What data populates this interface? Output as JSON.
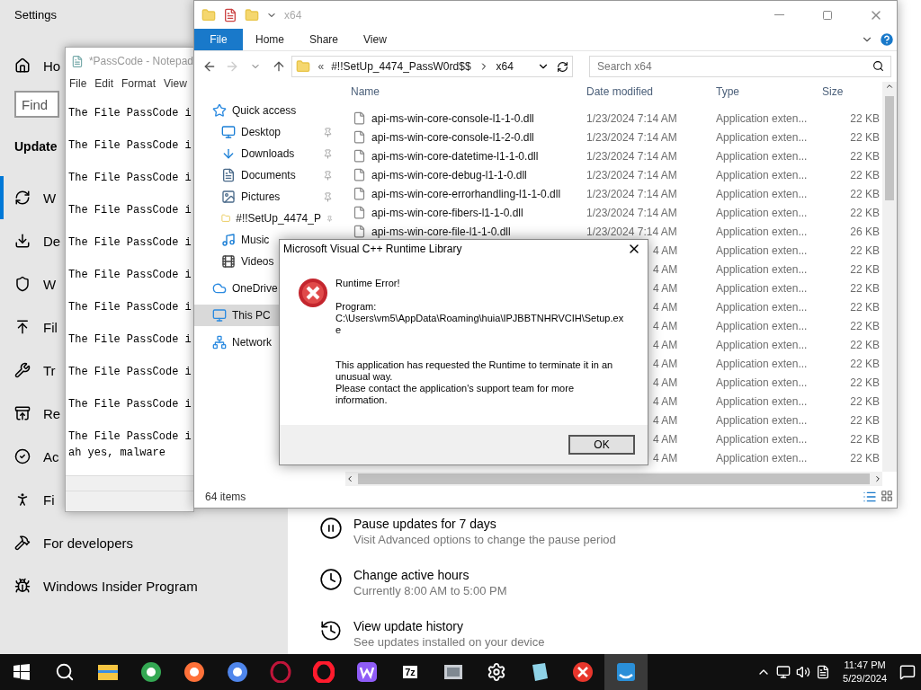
{
  "settings": {
    "title": "Settings",
    "home": "Ho",
    "search": {
      "placeholder": "Find"
    },
    "section": "Update",
    "nav": [
      {
        "label": "W",
        "selected": true
      },
      {
        "label": "De",
        "selected": false
      },
      {
        "label": "W",
        "selected": false
      },
      {
        "label": "Fil",
        "selected": false
      },
      {
        "label": "Tr",
        "selected": false
      },
      {
        "label": "Re",
        "selected": false
      },
      {
        "label": "Ac",
        "selected": false
      },
      {
        "label": "Fi",
        "selected": false
      },
      {
        "label": "For developers",
        "selected": false
      },
      {
        "label": "Windows Insider Program",
        "selected": false
      }
    ],
    "options": [
      {
        "title": "Pause updates for 7 days",
        "subtitle": "Visit Advanced options to change the pause period"
      },
      {
        "title": "Change active hours",
        "subtitle": "Currently 8:00 AM to 5:00 PM"
      },
      {
        "title": "View update history",
        "subtitle": "See updates installed on your device"
      }
    ]
  },
  "notepad": {
    "title": "*PassCode - Notepad",
    "menu": [
      "File",
      "Edit",
      "Format",
      "View"
    ],
    "lines": [
      "The File PassCode i",
      "The File PassCode i",
      "The File PassCode i",
      "The File PassCode i",
      "The File PassCode i",
      "The File PassCode i",
      "The File PassCode i",
      "The File PassCode i",
      "The File PassCode i",
      "The File PassCode i",
      "The File PassCode i",
      "ah yes, malware"
    ]
  },
  "explorer": {
    "title": "x64",
    "file_menu": "File",
    "ribbon_tabs": [
      "Home",
      "Share",
      "View"
    ],
    "address": {
      "prefix": "«",
      "crumbs": [
        "#!!SetUp_4474_PassW0rd$$",
        "x64"
      ]
    },
    "search": {
      "placeholder": "Search x64"
    },
    "nav": [
      {
        "kind": "group",
        "label": "Quick access",
        "selected": false
      },
      {
        "kind": "item",
        "label": "Desktop",
        "selected": false,
        "pinned": true
      },
      {
        "kind": "item",
        "label": "Downloads",
        "selected": false,
        "pinned": true
      },
      {
        "kind": "item",
        "label": "Documents",
        "selected": false,
        "pinned": true
      },
      {
        "kind": "item",
        "label": "Pictures",
        "selected": false,
        "pinned": true
      },
      {
        "kind": "item",
        "label": "#!!SetUp_4474_P",
        "selected": false,
        "pinned": true
      },
      {
        "kind": "item",
        "label": "Music",
        "selected": false,
        "pinned": false
      },
      {
        "kind": "item",
        "label": "Videos",
        "selected": false,
        "pinned": false
      },
      {
        "kind": "group",
        "label": "OneDrive",
        "selected": false
      },
      {
        "kind": "group",
        "label": "This PC",
        "selected": true
      },
      {
        "kind": "group",
        "label": "Network",
        "selected": false
      }
    ],
    "columns": [
      "Name",
      "Date modified",
      "Type",
      "Size"
    ],
    "rows": [
      {
        "kind": "full",
        "name": "api-ms-win-core-console-l1-1-0.dll",
        "date": "1/23/2024 7:14 AM",
        "type": "Application exten...",
        "size": "22 KB"
      },
      {
        "kind": "full",
        "name": "api-ms-win-core-console-l1-2-0.dll",
        "date": "1/23/2024 7:14 AM",
        "type": "Application exten...",
        "size": "22 KB"
      },
      {
        "kind": "full",
        "name": "api-ms-win-core-datetime-l1-1-0.dll",
        "date": "1/23/2024 7:14 AM",
        "type": "Application exten...",
        "size": "22 KB"
      },
      {
        "kind": "full",
        "name": "api-ms-win-core-debug-l1-1-0.dll",
        "date": "1/23/2024 7:14 AM",
        "type": "Application exten...",
        "size": "22 KB"
      },
      {
        "kind": "full",
        "name": "api-ms-win-core-errorhandling-l1-1-0.dll",
        "date": "1/23/2024 7:14 AM",
        "type": "Application exten...",
        "size": "22 KB"
      },
      {
        "kind": "full",
        "name": "api-ms-win-core-fibers-l1-1-0.dll",
        "date": "1/23/2024 7:14 AM",
        "type": "Application exten...",
        "size": "22 KB"
      },
      {
        "kind": "full",
        "name": "api-ms-win-core-file-l1-1-0.dll",
        "date": "1/23/2024 7:14 AM",
        "type": "Application exten...",
        "size": "26 KB"
      },
      {
        "kind": "covered",
        "date": "4 AM",
        "type": "Application exten...",
        "size": "22 KB"
      },
      {
        "kind": "covered",
        "date": "4 AM",
        "type": "Application exten...",
        "size": "22 KB"
      },
      {
        "kind": "covered",
        "date": "4 AM",
        "type": "Application exten...",
        "size": "22 KB"
      },
      {
        "kind": "covered",
        "date": "4 AM",
        "type": "Application exten...",
        "size": "22 KB"
      },
      {
        "kind": "covered",
        "date": "4 AM",
        "type": "Application exten...",
        "size": "22 KB"
      },
      {
        "kind": "covered",
        "date": "4 AM",
        "type": "Application exten...",
        "size": "22 KB"
      },
      {
        "kind": "covered",
        "date": "4 AM",
        "type": "Application exten...",
        "size": "22 KB"
      },
      {
        "kind": "covered",
        "date": "4 AM",
        "type": "Application exten...",
        "size": "22 KB"
      },
      {
        "kind": "covered",
        "date": "4 AM",
        "type": "Application exten...",
        "size": "22 KB"
      },
      {
        "kind": "covered",
        "date": "4 AM",
        "type": "Application exten...",
        "size": "22 KB"
      },
      {
        "kind": "covered",
        "date": "4 AM",
        "type": "Application exten...",
        "size": "22 KB"
      },
      {
        "kind": "covered",
        "date": "4 AM",
        "type": "Application exten...",
        "size": "22 KB"
      }
    ],
    "status": "64 items"
  },
  "dialog": {
    "title": "Microsoft Visual C++ Runtime Library",
    "heading": "Runtime Error!",
    "program_label": "Program:",
    "program_path": "C:\\Users\\vm5\\AppData\\Roaming\\huia\\IPJBBTNHRVCIH\\Setup.exe",
    "message": [
      "This application has requested the Runtime to terminate it in an unusual way.",
      "Please contact the application's support team for more information."
    ],
    "button": "OK"
  },
  "taskbar": {
    "apps": [
      {
        "kind": "explorer",
        "selected": false
      },
      {
        "kind": "chrome",
        "selected": false
      },
      {
        "kind": "firefox",
        "selected": false
      },
      {
        "kind": "chromium",
        "selected": false
      },
      {
        "kind": "opera-outline",
        "selected": false
      },
      {
        "kind": "opera",
        "selected": false
      },
      {
        "kind": "w-app",
        "selected": false
      },
      {
        "kind": "sevenzip",
        "label": "7z",
        "selected": false
      },
      {
        "kind": "image-app",
        "selected": false
      },
      {
        "kind": "settings",
        "selected": false
      },
      {
        "kind": "notes",
        "selected": false
      },
      {
        "kind": "error",
        "selected": false
      },
      {
        "kind": "setup",
        "selected": true
      }
    ],
    "time": "11:47 PM",
    "date": "5/29/2024"
  }
}
